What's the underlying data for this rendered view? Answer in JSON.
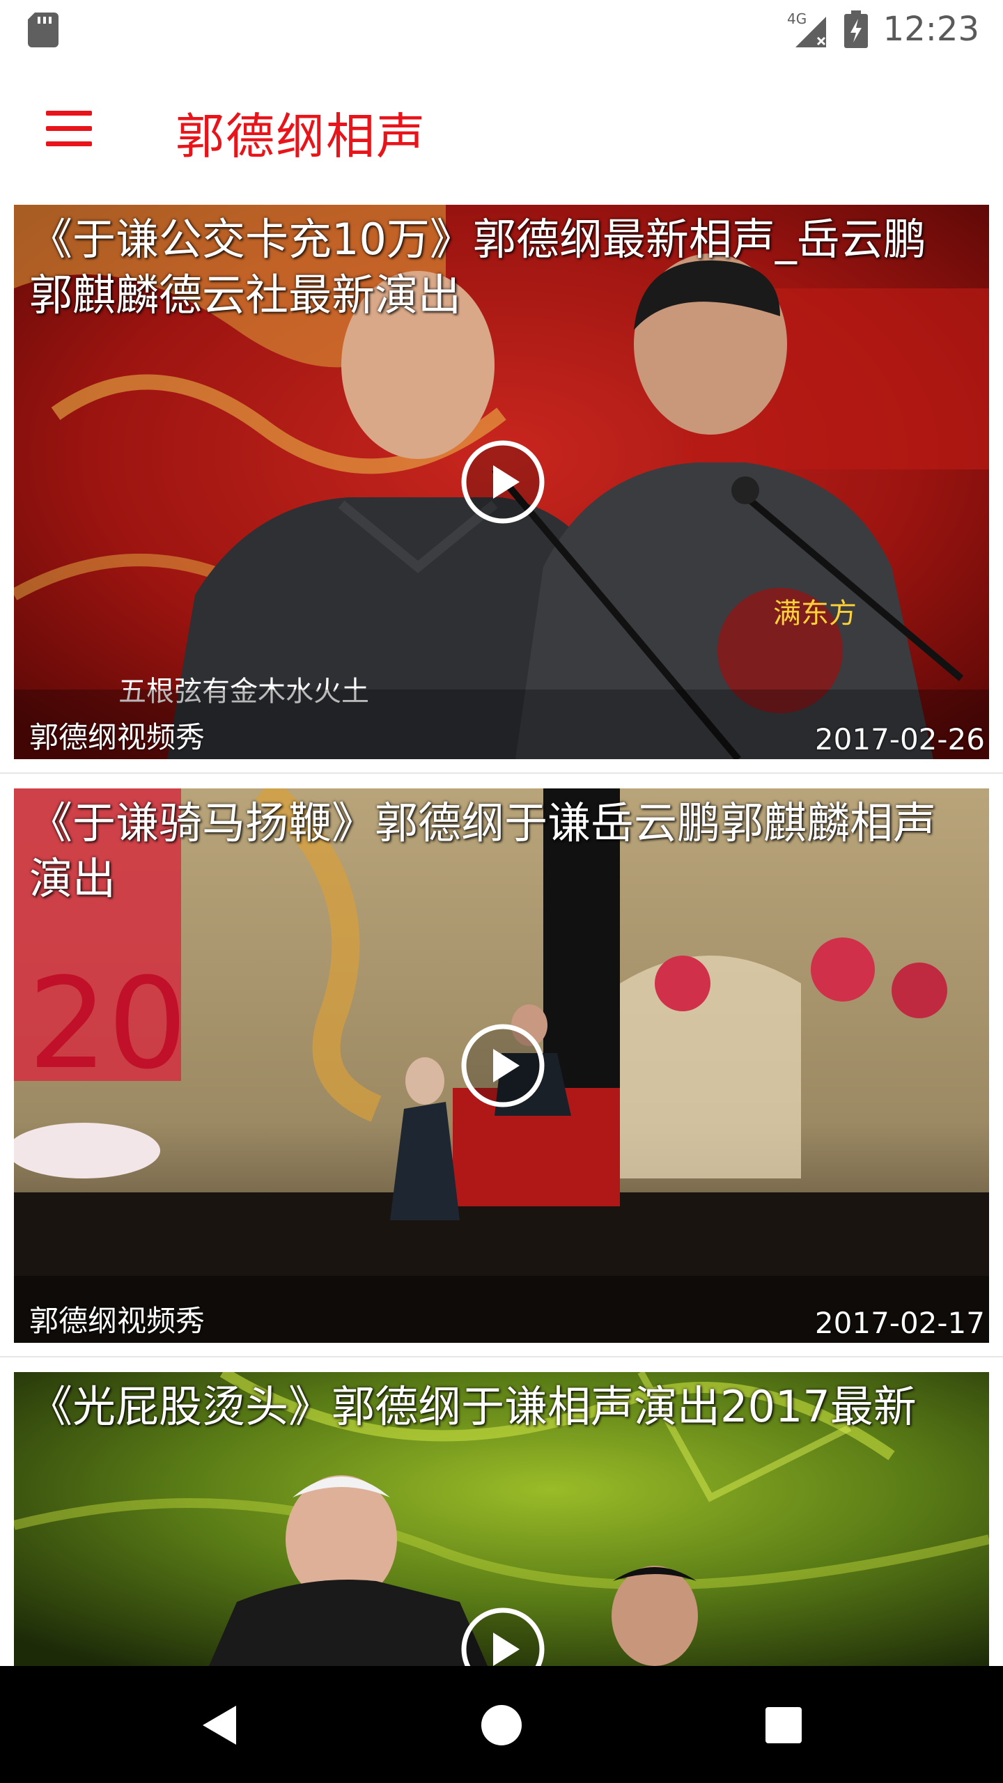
{
  "status_bar": {
    "network": "4G",
    "time": "12:23",
    "icons": [
      "sd-card-icon",
      "signal-icon",
      "battery-charging-icon"
    ]
  },
  "app_bar": {
    "title": "郭德纲相声",
    "menu_icon": "menu-icon",
    "accent_color": "#e8141a"
  },
  "videos": [
    {
      "title": "《于谦公交卡充10万》郭德纲最新相声_岳云鹏郭麒麟德云社最新演出",
      "source": "郭德纲视频秀",
      "date": "2017-02-26",
      "subtitle_overlay": "五根弦有金木水火土",
      "play_icon": "play-icon"
    },
    {
      "title": "《于谦骑马扬鞭》郭德纲于谦岳云鹏郭麒麟相声演出",
      "source": "郭德纲视频秀",
      "date": "2017-02-17",
      "play_icon": "play-icon"
    },
    {
      "title": "《光屁股烫头》郭德纲于谦相声演出2017最新",
      "play_icon": "play-icon"
    }
  ],
  "nav_bar": {
    "back_icon": "back-icon",
    "home_icon": "home-icon",
    "recents_icon": "recents-icon"
  }
}
